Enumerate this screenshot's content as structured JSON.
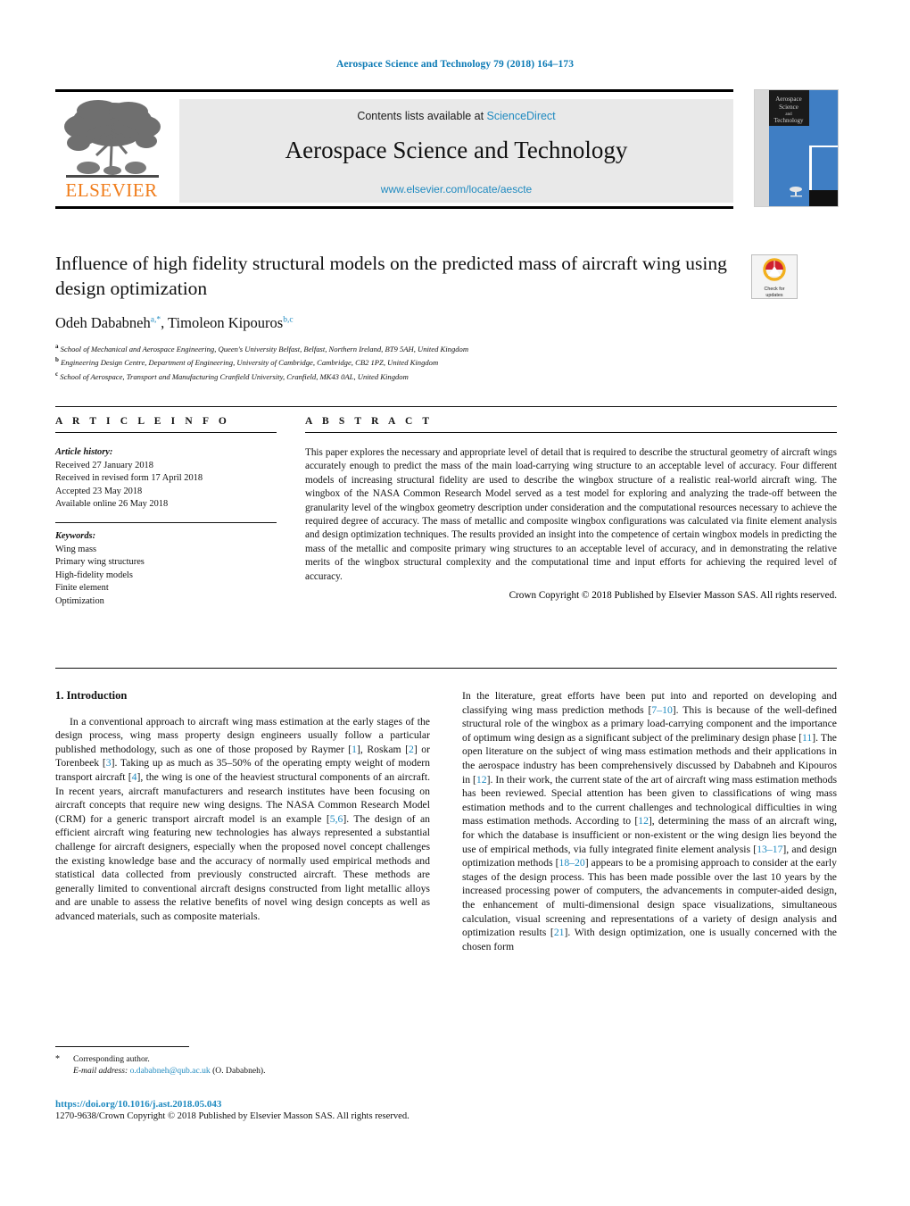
{
  "running_head": "Aerospace Science and Technology 79 (2018) 164–173",
  "masthead": {
    "contents_prefix": "Contents lists available at ",
    "sciencedirect": "ScienceDirect",
    "journal_title": "Aerospace Science and Technology",
    "journal_url": "www.elsevier.com/locate/aescte",
    "publisher_wordmark": "ELSEVIER",
    "cover_title_lines": [
      "Aerospace",
      "Science",
      "and",
      "Technology"
    ]
  },
  "article": {
    "title": "Influence of high fidelity structural models on the predicted mass of aircraft wing using design optimization",
    "crossmark_line1": "Check for",
    "crossmark_line2": "updates",
    "authors_html": "Odeh Dababneh<sup>a,*</sup>, Timoleon Kipouros<sup>b,c</sup>",
    "affiliations": [
      {
        "marker": "a",
        "text": "School of Mechanical and Aerospace Engineering, Queen's University Belfast, Belfast, Northern Ireland, BT9 5AH, United Kingdom"
      },
      {
        "marker": "b",
        "text": "Engineering Design Centre, Department of Engineering, University of Cambridge, Cambridge, CB2 1PZ, United Kingdom"
      },
      {
        "marker": "c",
        "text": "School of Aerospace, Transport and Manufacturing Cranfield University, Cranfield, MK43 0AL, United Kingdom"
      }
    ]
  },
  "info": {
    "heading": "A R T I C L E   I N F O",
    "history_label": "Article history:",
    "history": [
      "Received 27 January 2018",
      "Received in revised form 17 April 2018",
      "Accepted 23 May 2018",
      "Available online 26 May 2018"
    ],
    "keywords_label": "Keywords:",
    "keywords": [
      "Wing mass",
      "Primary wing structures",
      "High-fidelity models",
      "Finite element",
      "Optimization"
    ]
  },
  "abstract": {
    "heading": "A B S T R A C T",
    "text": "This paper explores the necessary and appropriate level of detail that is required to describe the structural geometry of aircraft wings accurately enough to predict the mass of the main load-carrying wing structure to an acceptable level of accuracy. Four different models of increasing structural fidelity are used to describe the wingbox structure of a realistic real-world aircraft wing. The wingbox of the NASA Common Research Model served as a test model for exploring and analyzing the trade-off between the granularity level of the wingbox geometry description under consideration and the computational resources necessary to achieve the required degree of accuracy. The mass of metallic and composite wingbox configurations was calculated via finite element analysis and design optimization techniques. The results provided an insight into the competence of certain wingbox models in predicting the mass of the metallic and composite primary wing structures to an acceptable level of accuracy, and in demonstrating the relative merits of the wingbox structural complexity and the computational time and input efforts for achieving the required level of accuracy.",
    "copyright": "Crown Copyright © 2018 Published by Elsevier Masson SAS. All rights reserved."
  },
  "body": {
    "section_number_title": "1. Introduction",
    "left_paragraph_html": "In a conventional approach to aircraft wing mass estimation at the early stages of the design process, wing mass property design engineers usually follow a particular published methodology, such as one of those proposed by Raymer [<span class=\"ref\">1</span>], Roskam [<span class=\"ref\">2</span>] or Torenbeek [<span class=\"ref\">3</span>]. Taking up as much as 35–50% of the operating empty weight of modern transport aircraft [<span class=\"ref\">4</span>], the wing is one of the heaviest structural components of an aircraft. In recent years, aircraft manufacturers and research institutes have been focusing on aircraft concepts that require new wing designs. The NASA Common Research Model (CRM) for a generic transport aircraft model is an example [<span class=\"ref\">5,6</span>]. The design of an efficient aircraft wing featuring new technologies has always represented a substantial challenge for aircraft designers, especially when the proposed novel concept challenges the existing knowledge base and the accuracy of normally used empirical methods and statistical data collected from previously constructed aircraft. These methods are generally limited to conventional aircraft designs constructed from light metallic alloys and are unable to assess the relative benefits of novel wing design concepts as well as advanced materials, such as composite materials.",
    "right_paragraph_html": "In the literature, great efforts have been put into and reported on developing and classifying wing mass prediction methods [<span class=\"ref\">7–10</span>]. This is because of the well-defined structural role of the wingbox as a primary load-carrying component and the importance of optimum wing design as a significant subject of the preliminary design phase [<span class=\"ref\">11</span>]. The open literature on the subject of wing mass estimation methods and their applications in the aerospace industry has been comprehensively discussed by Dababneh and Kipouros in [<span class=\"ref\">12</span>]. In their work, the current state of the art of aircraft wing mass estimation methods has been reviewed. Special attention has been given to classifications of wing mass estimation methods and to the current challenges and technological difficulties in wing mass estimation methods. According to [<span class=\"ref\">12</span>], determining the mass of an aircraft wing, for which the database is insufficient or non-existent or the wing design lies beyond the use of empirical methods, via fully integrated finite element analysis [<span class=\"ref\">13–17</span>], and design optimization methods [<span class=\"ref\">18–20</span>] appears to be a promising approach to consider at the early stages of the design process. This has been made possible over the last 10 years by the increased processing power of computers, the advancements in computer-aided design, the enhancement of multi-dimensional design space visualizations, simultaneous calculation, visual screening and representations of a variety of design analysis and optimization results [<span class=\"ref\">21</span>]. With design optimization, one is usually concerned with the chosen form"
  },
  "footnote": {
    "star": "*",
    "corresponding": "Corresponding author.",
    "email_label": "E-mail address:",
    "email": "o.dababneh@qub.ac.uk",
    "email_suffix": "(O. Dababneh)."
  },
  "footer": {
    "doi": "https://doi.org/10.1016/j.ast.2018.05.043",
    "issn_line": "1270-9638/Crown Copyright © 2018 Published by Elsevier Masson SAS. All rights reserved."
  },
  "colors": {
    "link_blue": "#1f8ac0",
    "head_blue": "#0b7ab5",
    "elsevier_orange": "#f07c1a",
    "cover_blue": "#3f7ec4",
    "masthead_grey": "#e9e9e9"
  }
}
